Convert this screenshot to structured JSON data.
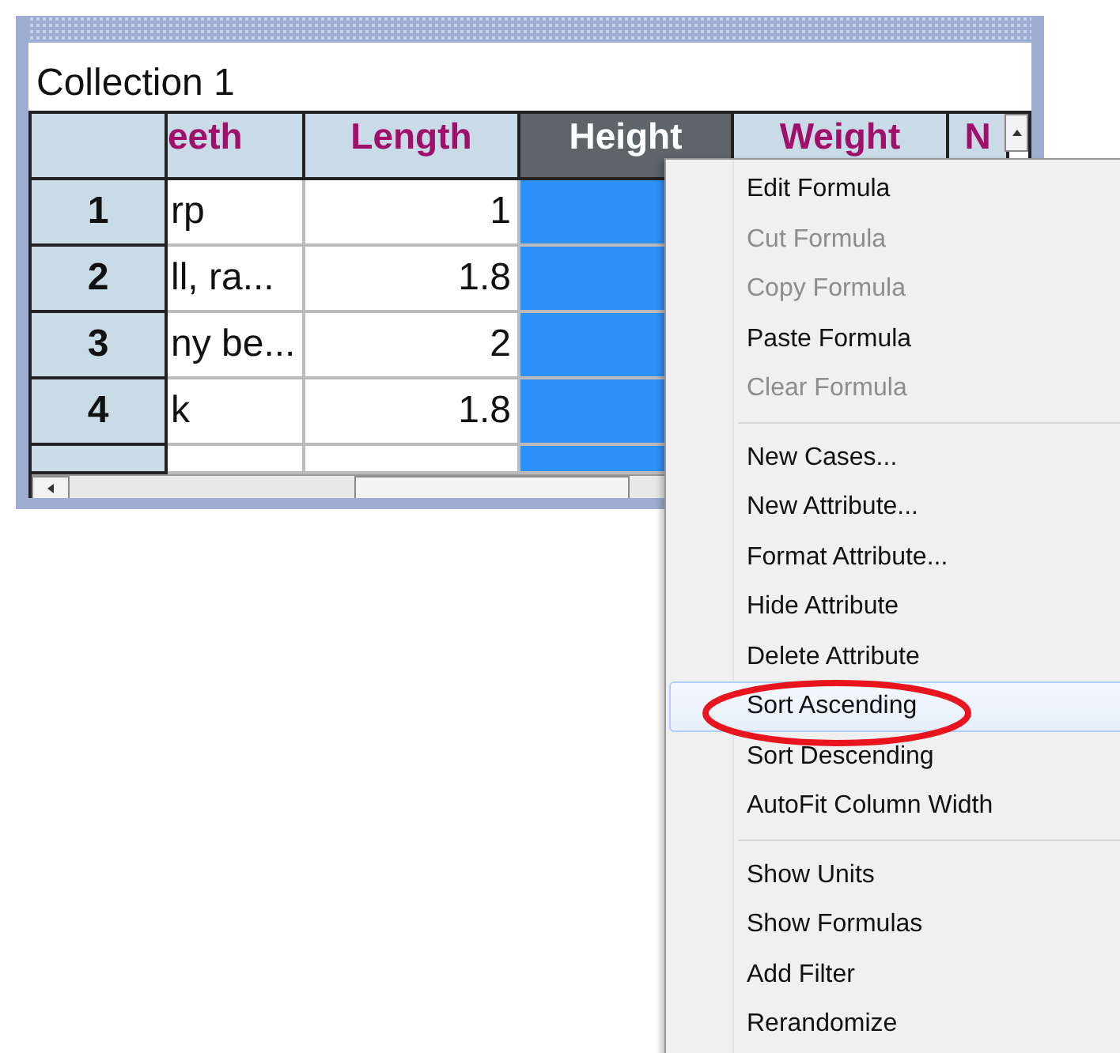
{
  "window": {
    "title": "Collection 1"
  },
  "table": {
    "columns": [
      {
        "label": "eeth",
        "selected": false
      },
      {
        "label": "Length",
        "selected": false
      },
      {
        "label": "Height",
        "selected": true
      },
      {
        "label": "Weight",
        "selected": false
      },
      {
        "label": "N",
        "selected": false
      }
    ],
    "rows": [
      {
        "index": "1",
        "cells": [
          "rp",
          "1"
        ]
      },
      {
        "index": "2",
        "cells": [
          "ll, ra...",
          "1.8"
        ]
      },
      {
        "index": "3",
        "cells": [
          "ny be...",
          "2"
        ]
      },
      {
        "index": "4",
        "cells": [
          "k",
          "1.8"
        ]
      }
    ]
  },
  "context_menu": {
    "groups": [
      [
        {
          "label": "Edit Formula",
          "disabled": false,
          "selected": false
        },
        {
          "label": "Cut Formula",
          "disabled": true,
          "selected": false
        },
        {
          "label": "Copy Formula",
          "disabled": true,
          "selected": false
        },
        {
          "label": "Paste Formula",
          "disabled": false,
          "selected": false
        },
        {
          "label": "Clear Formula",
          "disabled": true,
          "selected": false
        }
      ],
      [
        {
          "label": "New Cases...",
          "disabled": false,
          "selected": false
        },
        {
          "label": "New Attribute...",
          "disabled": false,
          "selected": false
        },
        {
          "label": "Format Attribute...",
          "disabled": false,
          "selected": false
        },
        {
          "label": "Hide Attribute",
          "disabled": false,
          "selected": false
        },
        {
          "label": "Delete Attribute",
          "disabled": false,
          "selected": false
        },
        {
          "label": "Sort Ascending",
          "disabled": false,
          "selected": true
        },
        {
          "label": "Sort Descending",
          "disabled": false,
          "selected": false
        },
        {
          "label": "AutoFit Column Width",
          "disabled": false,
          "selected": false
        }
      ],
      [
        {
          "label": "Show Units",
          "disabled": false,
          "selected": false
        },
        {
          "label": "Show Formulas",
          "disabled": false,
          "selected": false
        },
        {
          "label": "Add Filter",
          "disabled": false,
          "selected": false
        },
        {
          "label": "Rerandomize",
          "disabled": false,
          "selected": false
        }
      ]
    ]
  }
}
